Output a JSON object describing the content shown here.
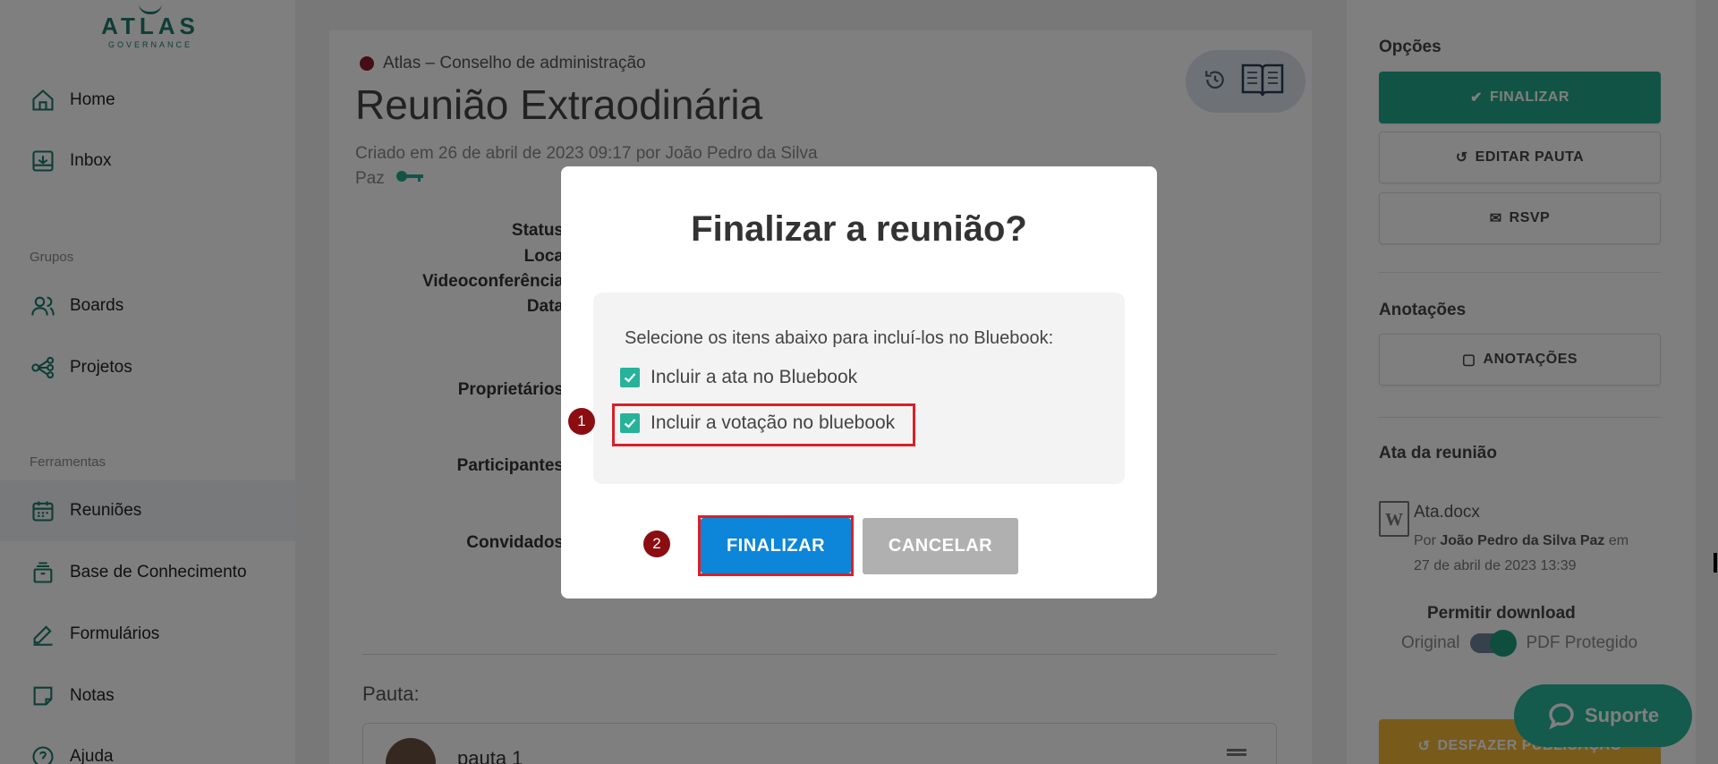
{
  "sidebar": {
    "logo_name": "ATLAS",
    "logo_sub": "GOVERNANCE",
    "items": [
      {
        "label": "Home",
        "icon": "home-icon"
      },
      {
        "label": "Inbox",
        "icon": "inbox-icon"
      },
      {
        "label": "Boards",
        "icon": "users-icon"
      },
      {
        "label": "Projetos",
        "icon": "network-icon"
      },
      {
        "label": "Reuniões",
        "icon": "calendar-icon"
      },
      {
        "label": "Base de Conhecimento",
        "icon": "archive-icon"
      },
      {
        "label": "Formulários",
        "icon": "edit-icon"
      },
      {
        "label": "Notas",
        "icon": "note-icon"
      },
      {
        "label": "Ajuda",
        "icon": "help-icon"
      }
    ],
    "section_grupos": "Grupos",
    "section_ferramentas": "Ferramentas"
  },
  "meeting": {
    "org": "Atlas – Conselho de administração",
    "title": "Reunião Extraodinária",
    "created": "Criado em 26 de abril de 2023 09:17 por João Pedro da Silva Paz",
    "labels": {
      "status": "Status",
      "local": "Loca",
      "video": "Videoconferência",
      "data": "Data",
      "owners": "Proprietários",
      "participants": "Participantes",
      "guests": "Convidados"
    },
    "pauta_label": "Pauta:",
    "pauta_item": "pauta 1"
  },
  "right_panel": {
    "options_title": "Opções",
    "btn_finalizar": "FINALIZAR",
    "btn_editar": "EDITAR PAUTA",
    "btn_rsvp": "RSVP",
    "notes_title": "Anotações",
    "btn_notes": "ANOTAÇÕES",
    "minutes_title": "Ata da reunião",
    "file_name": "Ata.docx",
    "file_by_prefix": "Por",
    "file_author": "João Pedro da Silva Paz",
    "file_date": "em 27 de abril de 2023 13:39",
    "perm_title": "Permitir download",
    "perm_original": "Original",
    "perm_pdf": "PDF Protegido",
    "perm_toggle_on": true,
    "btn_undo": "DESFAZER PUBLICAÇÃO",
    "support": "Suporte"
  },
  "modal": {
    "title": "Finalizar a reunião?",
    "instructions": "Selecione os itens abaixo para incluí-los no Bluebook:",
    "check1": "Incluir a ata no Bluebook",
    "check1_checked": true,
    "check2": "Incluir a votação no bluebook",
    "check2_checked": true,
    "btn_confirm": "FINALIZAR",
    "btn_cancel": "CANCELAR",
    "badge1": "1",
    "badge2": "2"
  },
  "colors": {
    "brand": "#1f7a6a",
    "primary_teal": "#23a98a",
    "confirm_blue": "#0d85d8",
    "highlight_red": "#dc1f26",
    "badge_dark_red": "#8b0d12",
    "warning_yellow": "#f1b537"
  }
}
